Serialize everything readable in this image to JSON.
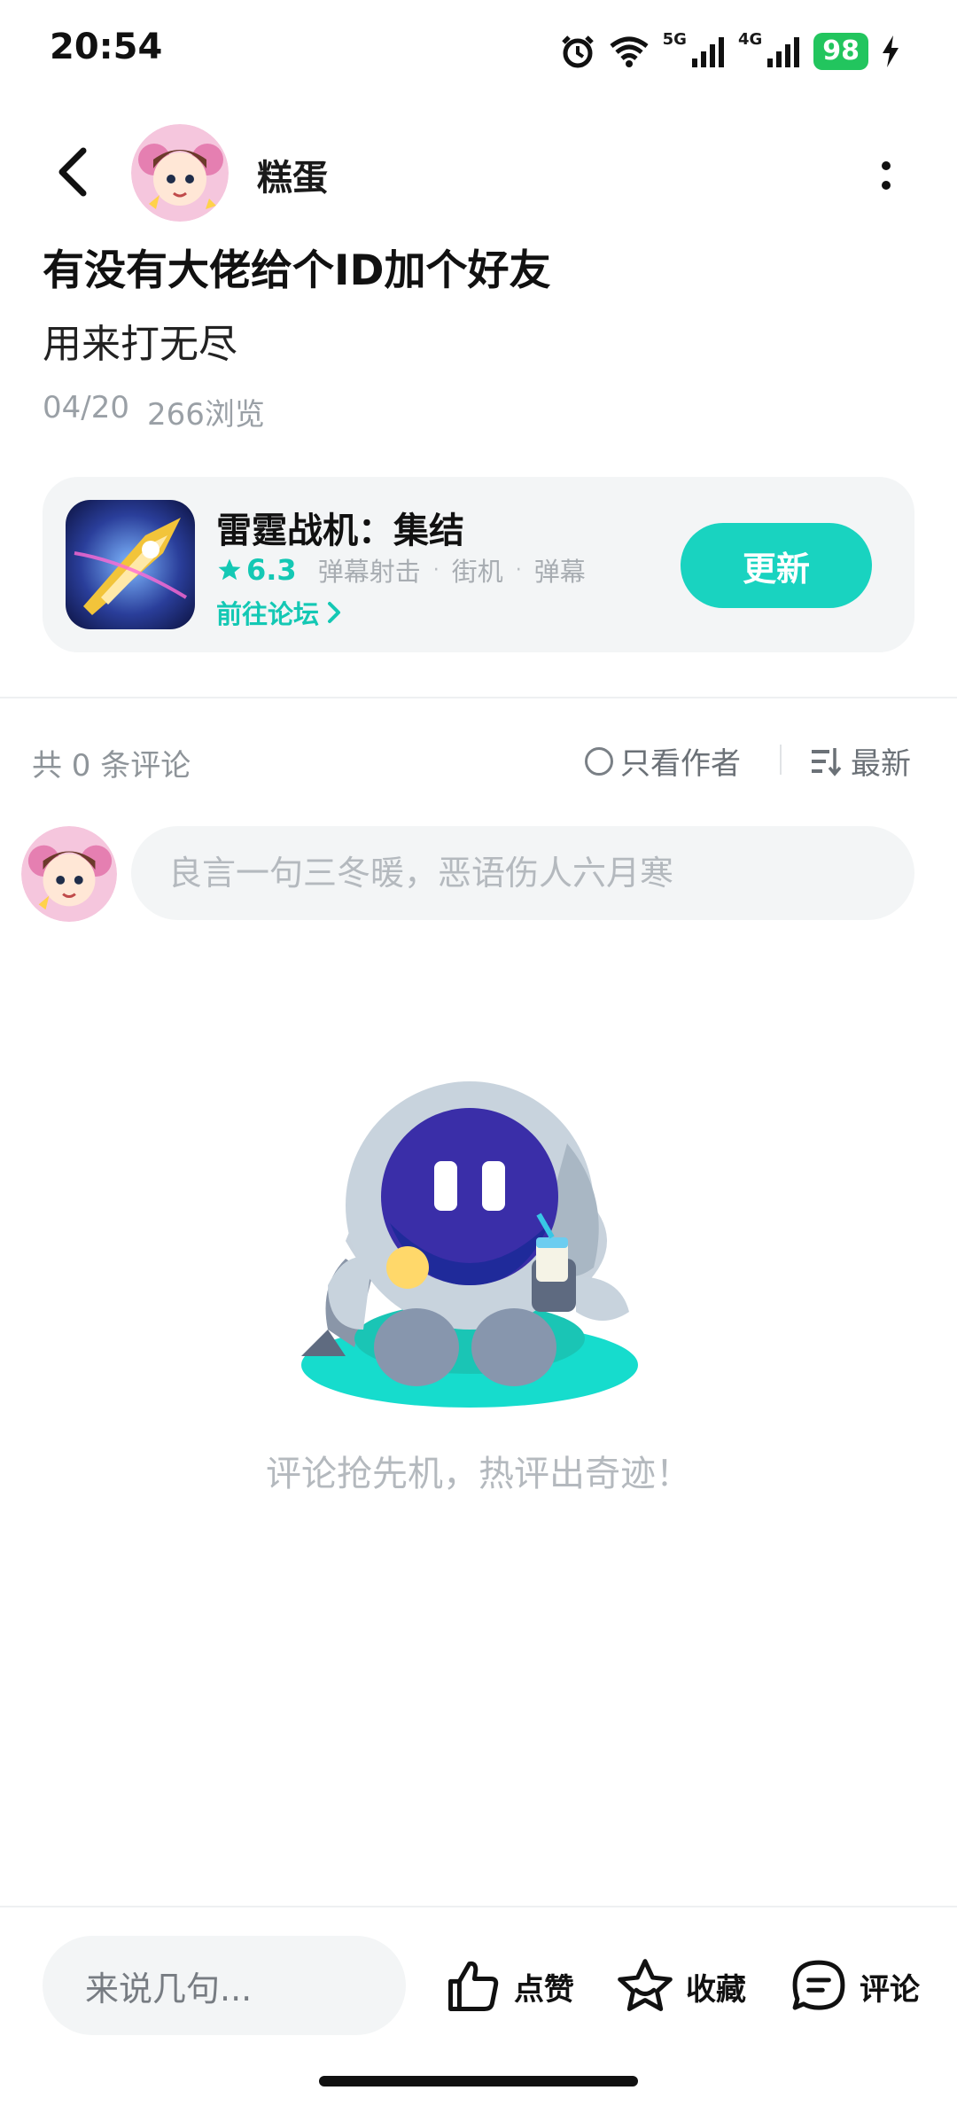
{
  "status_bar": {
    "time": "20:54",
    "network_5g": "5G",
    "network_4g": "4G",
    "battery": "98",
    "icons": [
      "alarm-icon",
      "wifi-icon",
      "signal-icon",
      "signal-icon",
      "battery-icon",
      "charging-icon"
    ]
  },
  "header": {
    "author_name": "糕蛋"
  },
  "post": {
    "title": "有没有大佬给个ID加个好友",
    "body": "用来打无尽",
    "date": "04/20",
    "views": "266浏览"
  },
  "game_card": {
    "name": "雷霆战机：集结",
    "rating": "6.3",
    "tags": [
      "弹幕射击",
      "街机",
      "弹幕"
    ],
    "forum_link": "前往论坛",
    "update_button": "更新"
  },
  "comments": {
    "count_label": "共 0 条评论",
    "only_author": "只看作者",
    "sort_label": "最新",
    "input_placeholder": "良言一句三冬暖，恶语伤人六月寒",
    "empty_text": "评论抢先机，热评出奇迹！"
  },
  "bottom_bar": {
    "input_placeholder": "来说几句...",
    "like_label": "点赞",
    "favorite_label": "收藏",
    "comment_label": "评论"
  },
  "colors": {
    "accent": "#19d3c0",
    "rating_text": "#14c8b4",
    "battery": "#22c55e",
    "muted_text": "#9aa0a6"
  }
}
